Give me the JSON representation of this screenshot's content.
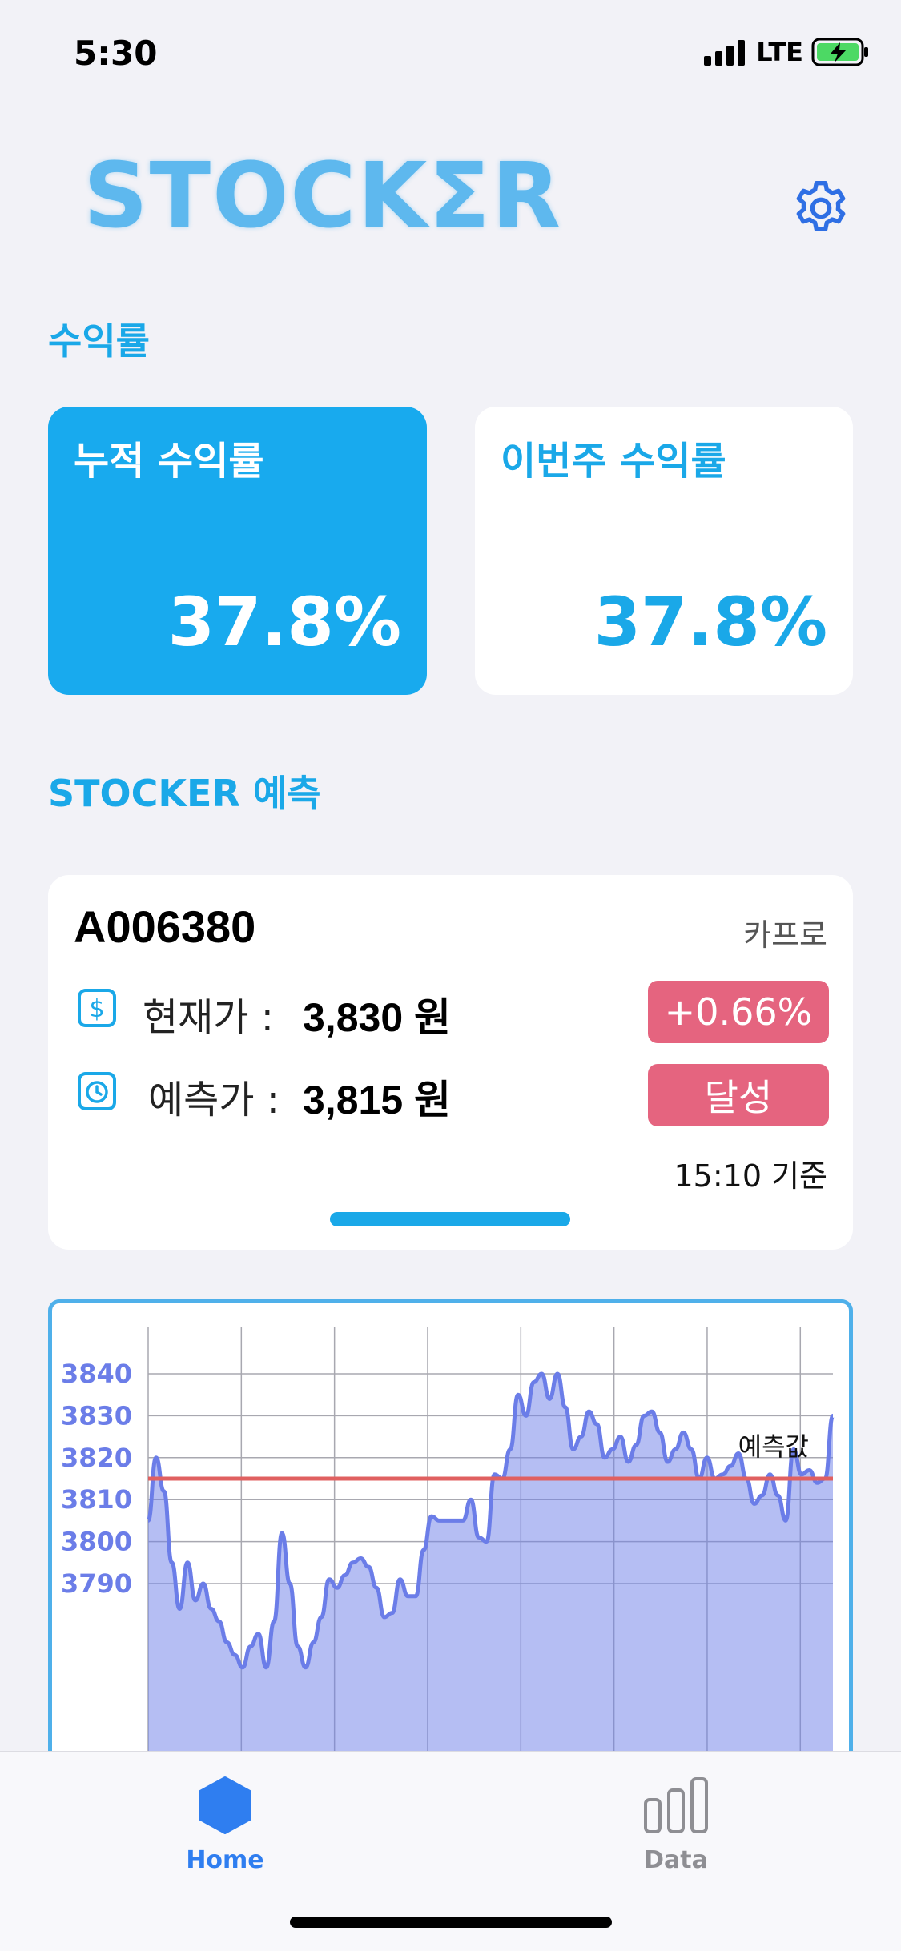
{
  "status_bar": {
    "time": "5:30",
    "network": "LTE"
  },
  "header": {
    "logo_text": "STOCKΣR"
  },
  "returns_section": {
    "title": "수익률",
    "cumulative": {
      "label": "누적 수익률",
      "value": "37.8%"
    },
    "weekly": {
      "label": "이번주 수익률",
      "value": "37.8%"
    }
  },
  "prediction_section": {
    "title": "STOCKER 예측",
    "code": "A006380",
    "company": "카프로",
    "current_label": "현재가 :",
    "current_value": "3,830 원",
    "current_badge": "+0.66%",
    "predicted_label": "예측가 :",
    "predicted_value": "3,815 원",
    "predicted_badge": "달성",
    "as_of": "15:10 기준"
  },
  "colors": {
    "accent": "#1aa8e8",
    "badge": "#e5647f",
    "series": "#6b7de8",
    "prediction_line": "#e06060"
  },
  "chart_data": {
    "type": "area",
    "ylim": [
      3788,
      3848
    ],
    "yticks": [
      3790,
      3800,
      3810,
      3820,
      3830,
      3840
    ],
    "prediction": {
      "label": "예측값",
      "value": 3815
    },
    "values": [
      3805,
      3820,
      3812,
      3795,
      3784,
      3795,
      3786,
      3790,
      3784,
      3781,
      3776,
      3773,
      3770,
      3775,
      3778,
      3770,
      3781,
      3802,
      3790,
      3775,
      3770,
      3776,
      3782,
      3791,
      3789,
      3792,
      3795,
      3796,
      3794,
      3789,
      3782,
      3783,
      3791,
      3787,
      3787,
      3798,
      3806,
      3805,
      3805,
      3805,
      3805,
      3810,
      3801,
      3800,
      3816,
      3815,
      3822,
      3835,
      3830,
      3838,
      3840,
      3834,
      3840,
      3832,
      3822,
      3825,
      3831,
      3828,
      3820,
      3822,
      3825,
      3819,
      3823,
      3830,
      3831,
      3826,
      3819,
      3822,
      3826,
      3822,
      3815,
      3820,
      3815,
      3816,
      3818,
      3821,
      3815,
      3809,
      3811,
      3816,
      3811,
      3805,
      3822,
      3816,
      3817,
      3814,
      3815,
      3830
    ]
  },
  "tab_bar": {
    "home_label": "Home",
    "data_label": "Data"
  }
}
